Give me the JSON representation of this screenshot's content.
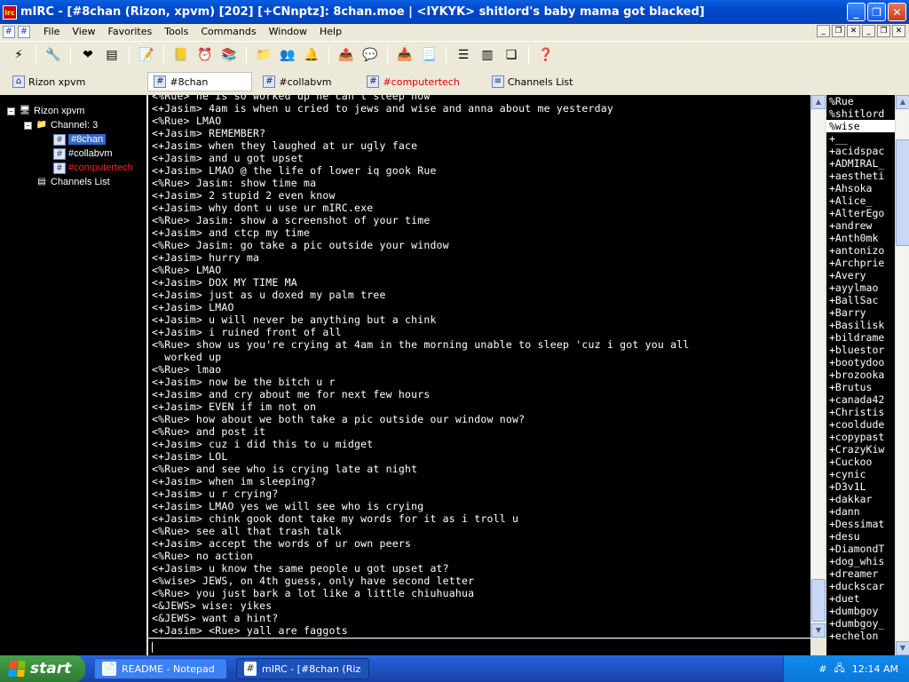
{
  "window": {
    "title": "mIRC - [#8chan (Rizon, xpvm) [202] [+CNnptz]: 8chan.moe | <IYKYK> shitlord's baby mama got blacked]",
    "icon_text": "irc"
  },
  "menu": {
    "items": [
      "File",
      "View",
      "Favorites",
      "Tools",
      "Commands",
      "Window",
      "Help"
    ]
  },
  "switchbar": {
    "items": [
      {
        "label": "Rizon xpvm",
        "icon": "server-icon",
        "red": false
      },
      {
        "label": "#8chan",
        "icon": "channel-icon",
        "red": false,
        "active": true
      },
      {
        "label": "#collabvm",
        "icon": "channel-icon",
        "red": false
      },
      {
        "label": "#computertech",
        "icon": "channel-icon",
        "red": true
      },
      {
        "label": "Channels List",
        "icon": "list-icon",
        "red": false
      }
    ]
  },
  "tree": {
    "server": "Rizon xpvm",
    "folder": "Channel: 3",
    "channels": [
      {
        "label": "#8chan",
        "selected": true,
        "red": false
      },
      {
        "label": "#collabvm",
        "selected": false,
        "red": false
      },
      {
        "label": "#computertech",
        "selected": false,
        "red": true
      }
    ],
    "list": "Channels List"
  },
  "chat": {
    "lines": [
      "<%Rue> he is so worked up he can't sleep now",
      "<+Jasim> 4am is when u cried to jews and wise and anna about me yesterday",
      "<%Rue> LMAO",
      "<+Jasim> REMEMBER?",
      "<+Jasim> when they laughed at ur ugly face",
      "<+Jasim> and u got upset",
      "<+Jasim> LMAO @ the life of lower iq gook Rue",
      "<%Rue> Jasim: show time ma",
      "<+Jasim> 2 stupid 2 even know",
      "<+Jasim> why dont u use ur mIRC.exe",
      "<%Rue> Jasim: show a screenshot of your time",
      "<+Jasim> and ctcp my time",
      "<%Rue> Jasim: go take a pic outside your window",
      "<+Jasim> hurry ma",
      "<%Rue> LMAO",
      "<+Jasim> DOX MY TIME MA",
      "<+Jasim> just as u doxed my palm tree",
      "<+Jasim> LMAO",
      "<+Jasim> u will never be anything but a chink",
      "<+Jasim> i ruined front of all",
      "<%Rue> show us you're crying at 4am in the morning unable to sleep 'cuz i got you all\n  worked up",
      "<%Rue> lmao",
      "<+Jasim> now be the bitch u r",
      "<+Jasim> and cry about me for next few hours",
      "<+Jasim> EVEN if im not on",
      "<%Rue> how about we both take a pic outside our window now?",
      "<%Rue> and post it",
      "<+Jasim> cuz i did this to u midget",
      "<+Jasim> LOL",
      "<%Rue> and see who is crying late at night",
      "<+Jasim> when im sleeping?",
      "<+Jasim> u r crying?",
      "<+Jasim> LMAO yes we will see who is crying",
      "<+Jasim> chink gook dont take my words for it as i troll u",
      "<%Rue> see all that trash talk",
      "<+Jasim> accept the words of ur own peers",
      "<%Rue> no action",
      "<+Jasim> u know the same people u got upset at?",
      "<%wise> JEWS, on 4th guess, only have second letter",
      "<%Rue> you just bark a lot like a little chiuhuahua",
      "<&JEWS> wise: yikes",
      "<&JEWS> want a hint?",
      "<+Jasim> <Rue> yall are faggots"
    ]
  },
  "nicklist": {
    "nicks": [
      "%Rue",
      "%shitlord",
      "%wise",
      "+__",
      "+acidspac",
      "+ADMIRAL_",
      "+aestheti",
      "+Ahsoka",
      "+Alice_",
      "+AlterEgo",
      "+andrew",
      "+Anth0mk",
      "+antonizo",
      "+Archprie",
      "+Avery",
      "+ayylmao",
      "+BallSac",
      "+Barry",
      "+Basilisk",
      "+bildrame",
      "+bluestor",
      "+bootydoo",
      "+brozooka",
      "+Brutus",
      "+canada42",
      "+Christis",
      "+cooldude",
      "+copypast",
      "+CrazyKiw",
      "+Cuckoo",
      "+cynic",
      "+D3v1L",
      "+dakkar",
      "+dann",
      "+Dessimat",
      "+desu",
      "+DiamondT",
      "+dog_whis",
      "+dreamer",
      "+duckscar",
      "+duet",
      "+dumbgoy",
      "+dumbgoy_",
      "+echelon"
    ],
    "selected": "%wise"
  },
  "taskbar": {
    "start_label": "start",
    "tasks": [
      {
        "label": "README - Notepad",
        "active": false,
        "icon": "notepad-icon"
      },
      {
        "label": "mIRC - [#8chan (Rizo...",
        "active": true,
        "icon": "mirc-icon"
      }
    ],
    "clock": "12:14 AM"
  }
}
